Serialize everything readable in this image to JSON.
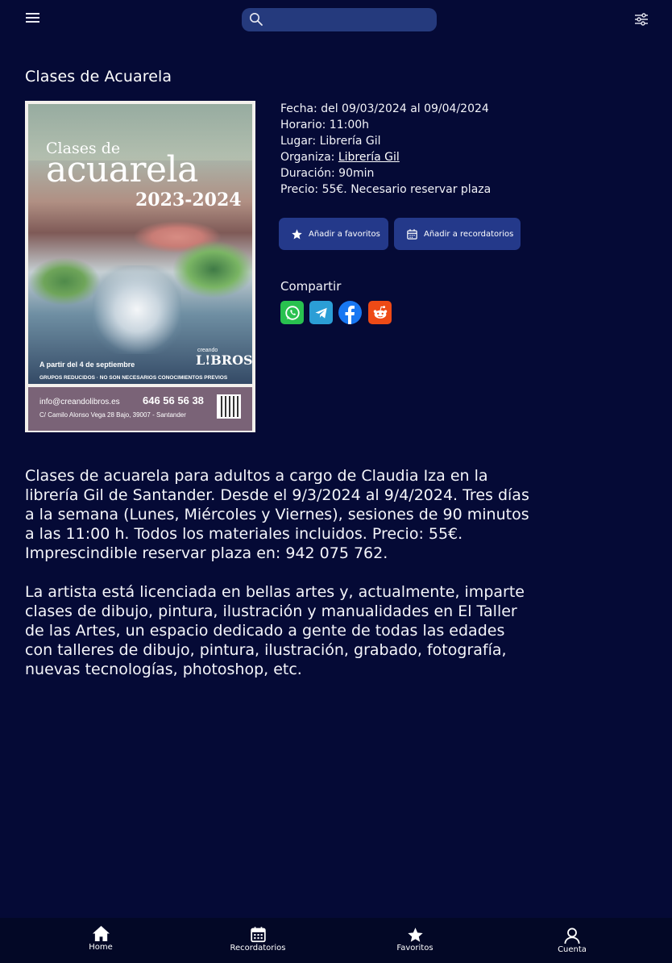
{
  "header": {
    "search_placeholder": "",
    "icons": [
      "menu-icon",
      "search-icon",
      "filter-icon"
    ]
  },
  "event": {
    "title": "Clases de Acuarela",
    "details": {
      "fecha": "Fecha: del 09/03/2024 al 09/04/2024",
      "horario": "Horario: 11:00h",
      "lugar": "Lugar: Librería Gil",
      "organiza_label": "Organiza: ",
      "organiza_link": "Librería Gil",
      "duracion": "Duración: 90min",
      "precio": "Precio: 55€. Necesario reservar plaza"
    },
    "buttons": {
      "favorites": "Añadir a favoritos",
      "reminders": "Añadir a recordatorios"
    },
    "share": {
      "title": "Compartir",
      "networks": [
        "whatsapp-icon",
        "telegram-icon",
        "facebook-icon",
        "reddit-icon"
      ]
    },
    "description": [
      "Clases de acuarela para adultos a cargo de Claudia Iza en la librería Gil de Santander. Desde el 9/3/2024 al 9/4/2024. Tres días a la semana (Lunes, Miércoles y Viernes), sesiones de 90 minutos a las 11:00 h. Todos los materiales incluidos. Precio: 55€. Imprescindible reservar plaza en: 942 075 762.",
      "La artista está licenciada en bellas artes y, actualmente, imparte clases de dibujo, pintura, ilustración y manualidades en El Taller de las Artes, un espacio dedicado a gente de todas las edades con talleres de dibujo, pintura, ilustración, grabado, fotografía, nuevas tecnologías, photoshop, etc."
    ]
  },
  "poster": {
    "line1": "Clases de",
    "line2": "acuarela",
    "year": "2023-2024",
    "start": "A partir del 4 de septiembre",
    "brand_small": "creando",
    "brand": "L!BROS",
    "groups": "GRUPOS REDUCIDOS · NO SON NECESARIOS CONOCIMIENTOS PREVIOS",
    "email": "info@creandolibros.es",
    "phone": "646 56 56 38",
    "address": "C/ Camilo Alonso Vega 28 Bajo, 39007 - Santander"
  },
  "nav": {
    "home": "Home",
    "reminders": "Recordatorios",
    "favorites": "Favoritos",
    "account": "Cuenta"
  },
  "colors": {
    "background": "#050a36",
    "button": "#24398a",
    "search": "#253a7d"
  }
}
